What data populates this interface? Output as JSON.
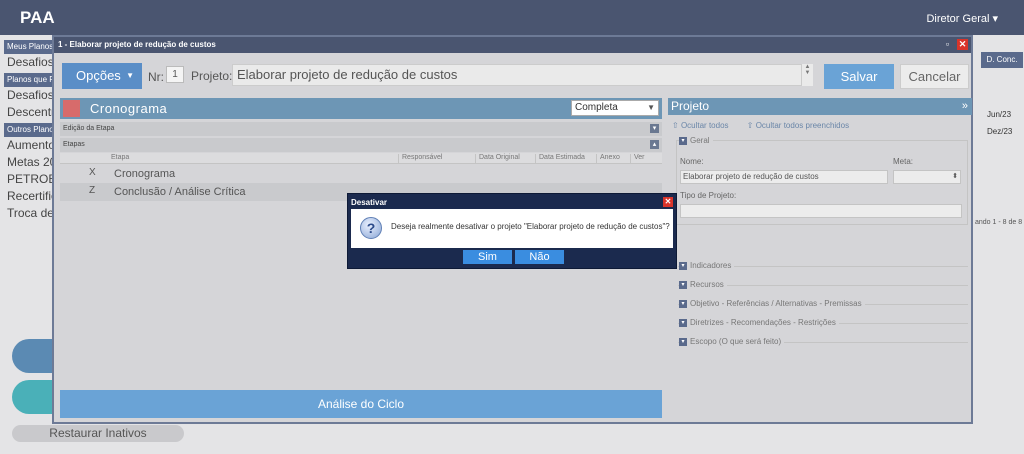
{
  "app": {
    "title": "PAA",
    "user_menu": "Diretor Geral ▾"
  },
  "background": {
    "sections": [
      {
        "label": "Meus Planos",
        "items": [
          "Desafios"
        ]
      },
      {
        "label": "Planos que P",
        "items": [
          "Desafios",
          "Descentra"
        ]
      },
      {
        "label": "Outros Plano",
        "items": [
          "Aumento",
          "Metas 20",
          "PETROBR",
          "Recertific",
          "Troca de"
        ]
      }
    ],
    "right_column_header": "D. Conc.",
    "right_dates": [
      "Jun/23",
      "Dez/23"
    ],
    "pager": "ando 1 - 8 de 8",
    "restore_button": "Restaurar Inativos"
  },
  "modal": {
    "title": "1 - Elaborar projeto de redução de custos",
    "toolbar": {
      "options_label": "Opções",
      "nr_label": "Nr:",
      "nr_value": "1",
      "project_label": "Projeto:",
      "project_value": "Elaborar projeto de redução de custos",
      "save_label": "Salvar",
      "cancel_label": "Cancelar"
    },
    "cronograma": {
      "title": "Cronograma",
      "filter_value": "Completa",
      "edicao_label": "Edição da Etapa",
      "etapas_label": "Etapas",
      "columns": [
        "Etapa",
        "Responsável",
        "Data Original",
        "Data Estimada",
        "Anexo",
        "Ver"
      ],
      "rows": [
        {
          "code": "X",
          "name": "Cronograma"
        },
        {
          "code": "Z",
          "name": "Conclusão / Análise Crítica"
        }
      ],
      "cycle_button": "Análise do Ciclo"
    },
    "projeto": {
      "title": "Projeto",
      "hide_all": "Ocultar todos",
      "hide_filled": "Ocultar todos preenchidos",
      "geral": {
        "label": "Geral",
        "name_label": "Nome:",
        "name_value": "Elaborar projeto de redução de custos",
        "meta_label": "Meta:",
        "type_label": "Tipo de Projeto:"
      },
      "sections": [
        "Indicadores",
        "Recursos",
        "Objetivo - Referências / Alternativas - Premissas",
        "Diretrizes - Recomendações - Restrições",
        "Escopo (O que será feito)"
      ]
    }
  },
  "dialog": {
    "title": "Desativar",
    "message": "Deseja realmente desativar o projeto \"Elaborar projeto de redução de custos\"?",
    "yes_label": "Sim",
    "no_label": "Não"
  },
  "colors": {
    "topbar": "#4a5570",
    "section_header": "#6d96b5",
    "primary_button": "#6aa3d6",
    "dialog_bg": "#1b2a4e",
    "dialog_button": "#3a8de0",
    "close_red": "#d9342b"
  }
}
